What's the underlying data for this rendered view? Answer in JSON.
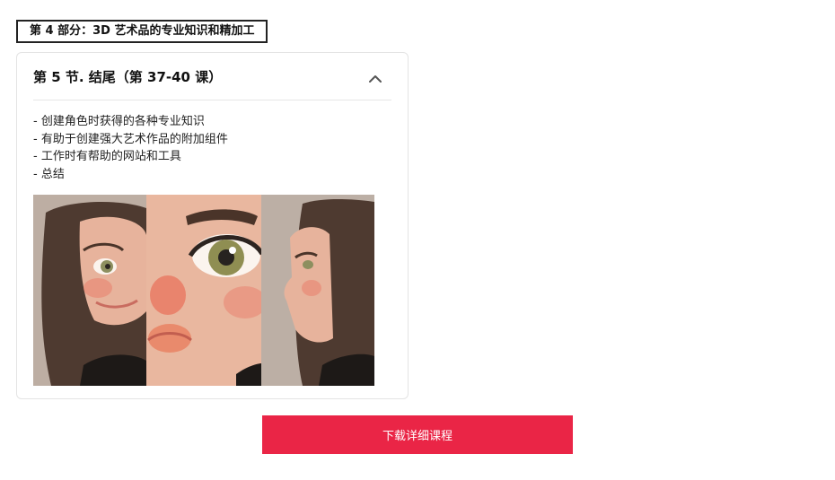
{
  "section": {
    "part_label": "第 4 部分：3D 艺术品的专业知识和精加工"
  },
  "lesson": {
    "title": "第 5 节. 结尾（第 37-40 课）",
    "toggle_icon": "chevron-up-icon",
    "bullets": [
      "- 创建角色时获得的各种专业知识",
      "- 有助于创建强大艺术作品的附加组件",
      "- 工作时有帮助的网站和工具",
      "- 总结"
    ]
  },
  "cta": {
    "label": "下载详细课程",
    "color": "#ea2546"
  }
}
